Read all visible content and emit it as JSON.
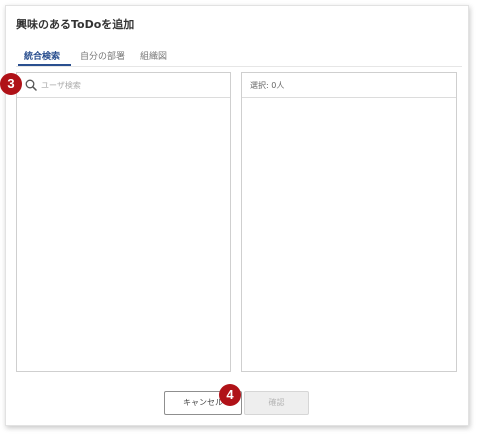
{
  "dialog": {
    "title": "興味のあるToDoを追加"
  },
  "tabs": [
    {
      "label": "統合検索",
      "active": true
    },
    {
      "label": "自分の部署",
      "active": false
    },
    {
      "label": "組織図",
      "active": false
    }
  ],
  "search": {
    "placeholder": "ユーザ検索",
    "icon": "search-icon"
  },
  "selected": {
    "label": "選択: 0人"
  },
  "buttons": {
    "cancel": "キャンセル",
    "confirm": "確認"
  },
  "markers": {
    "search": "3",
    "buttons": "4"
  },
  "colors": {
    "accent": "#2a4f8f",
    "marker": "#b01218",
    "disabled_text": "#b5b5b5"
  }
}
